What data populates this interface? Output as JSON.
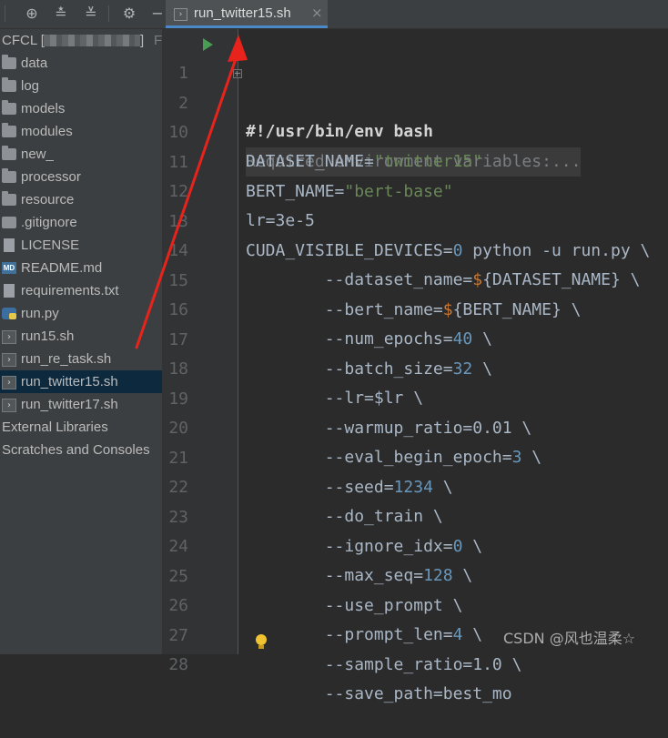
{
  "sidebar": {
    "project_root": "CFCL [",
    "project_root_suffix": "]",
    "trailing_letter": "F",
    "items": [
      {
        "label": "data",
        "icon": "folder-icon"
      },
      {
        "label": "log",
        "icon": "folder-icon"
      },
      {
        "label": "models",
        "icon": "folder-icon"
      },
      {
        "label": "modules",
        "icon": "folder-icon"
      },
      {
        "label": "new_",
        "icon": "folder-icon"
      },
      {
        "label": "processor",
        "icon": "folder-icon"
      },
      {
        "label": "resource",
        "icon": "folder-icon"
      },
      {
        "label": ".gitignore",
        "icon": "gitignore-file-icon"
      },
      {
        "label": "LICENSE",
        "icon": "text-file-icon"
      },
      {
        "label": "README.md",
        "icon": "markdown-file-icon"
      },
      {
        "label": "requirements.txt",
        "icon": "text-file-icon"
      },
      {
        "label": "run.py",
        "icon": "python-file-icon"
      },
      {
        "label": "run15.sh",
        "icon": "shell-script-icon"
      },
      {
        "label": "run_re_task.sh",
        "icon": "shell-script-icon"
      },
      {
        "label": "run_twitter15.sh",
        "icon": "shell-script-icon"
      },
      {
        "label": "run_twitter17.sh",
        "icon": "shell-script-icon"
      }
    ],
    "external_libraries": "External Libraries",
    "scratches": "Scratches and Consoles"
  },
  "editor": {
    "tab": {
      "label": "run_twitter15.sh",
      "close": "×"
    },
    "lines": [
      {
        "n": "1",
        "text": "#!/usr/bin/env bash"
      },
      {
        "n": "2",
        "text": "Required environment variables:..."
      },
      {
        "n": "10",
        "key": "DATASET_NAME=",
        "value": "\"twitter15\""
      },
      {
        "n": "11",
        "key": "BERT_NAME=",
        "value": "\"bert-base\""
      },
      {
        "n": "12",
        "text": "lr=3e-5"
      },
      {
        "n": "13",
        "a": "CUDA_VISIBLE_DEVICES=",
        "num": "0",
        "b": " python -u run.py \\"
      },
      {
        "n": "14",
        "a": "        --dataset_name=",
        "d": "$",
        "b": "{DATASET_NAME} \\"
      },
      {
        "n": "15",
        "a": "        --bert_name=",
        "d": "$",
        "b": "{BERT_NAME} \\"
      },
      {
        "n": "16",
        "a": "        --num_epochs=",
        "num": "40",
        "b": " \\"
      },
      {
        "n": "17",
        "a": "        --batch_size=",
        "num": "32",
        "b": " \\"
      },
      {
        "n": "18",
        "a": "        --lr=$lr \\"
      },
      {
        "n": "19",
        "a": "        --warmup_ratio=0.01 \\"
      },
      {
        "n": "20",
        "a": "        --eval_begin_epoch=",
        "num": "3",
        "b": " \\"
      },
      {
        "n": "21",
        "a": "        --seed=",
        "num": "1234",
        "b": " \\"
      },
      {
        "n": "22",
        "a": "        --do_train \\"
      },
      {
        "n": "23",
        "a": "        --ignore_idx=",
        "num": "0",
        "b": " \\"
      },
      {
        "n": "24",
        "a": "        --max_seq=",
        "num": "128",
        "b": " \\"
      },
      {
        "n": "25",
        "a": "        --use_prompt \\"
      },
      {
        "n": "26",
        "a": "        --prompt_len=",
        "num": "4",
        "b": " \\"
      },
      {
        "n": "27",
        "a": "        --sample_ratio=1.0 \\"
      },
      {
        "n": "28",
        "a": "        --save_path=best_mo"
      }
    ]
  },
  "watermark": "CSDN @风也温柔☆",
  "colors": {
    "annotation_arrow": "#e8231c",
    "run_icon": "#499c54",
    "selection": "#0d293e",
    "tab_underline": "#4a88c7"
  }
}
